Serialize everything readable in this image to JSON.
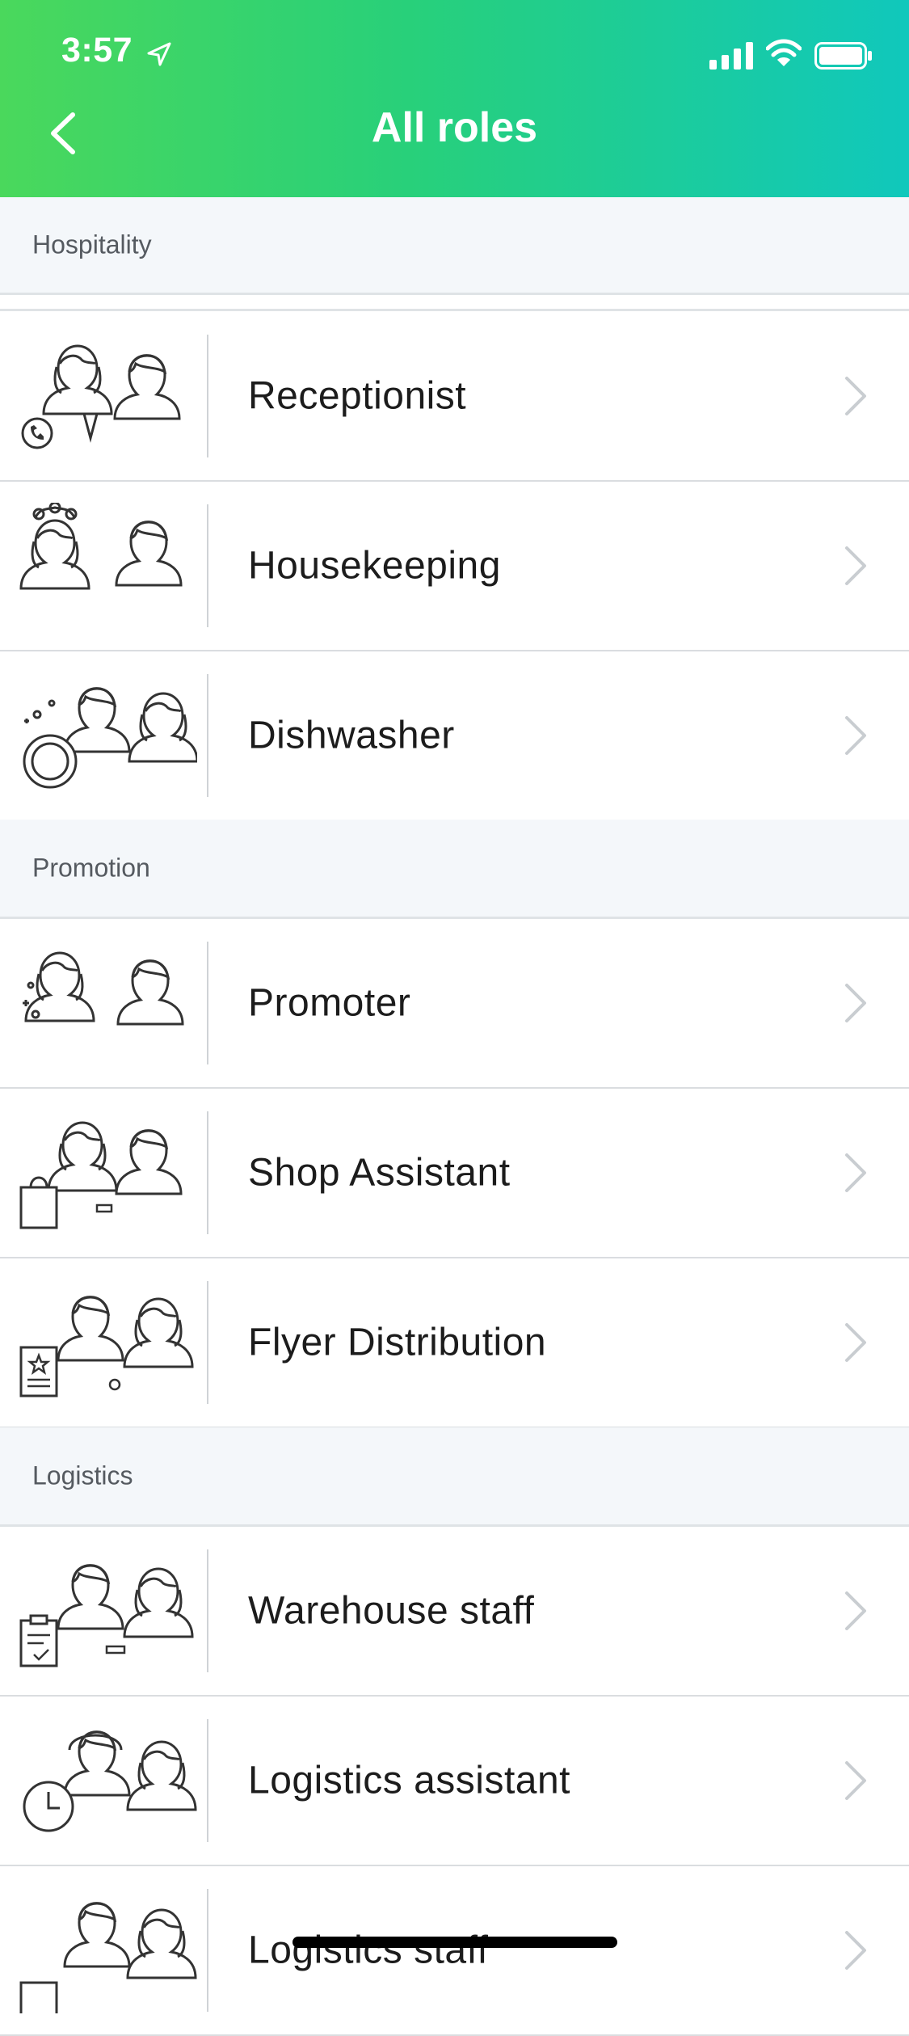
{
  "status_bar": {
    "time": "3:57"
  },
  "header": {
    "title": "All roles"
  },
  "sections": [
    {
      "label": "Hospitality"
    },
    {
      "label": "Promotion"
    },
    {
      "label": "Logistics"
    }
  ],
  "roles": [
    {
      "label": "Receptionist"
    },
    {
      "label": "Housekeeping"
    },
    {
      "label": "Dishwasher"
    },
    {
      "label": "Promoter"
    },
    {
      "label": "Shop Assistant"
    },
    {
      "label": "Flyer Distribution"
    },
    {
      "label": "Warehouse staff"
    },
    {
      "label": "Logistics assistant"
    },
    {
      "label": "Logistics staff"
    }
  ],
  "colors": {
    "header_gradient_start": "#4ad85c",
    "header_gradient_end": "#10c8bc",
    "section_bg": "#f4f7fa"
  }
}
